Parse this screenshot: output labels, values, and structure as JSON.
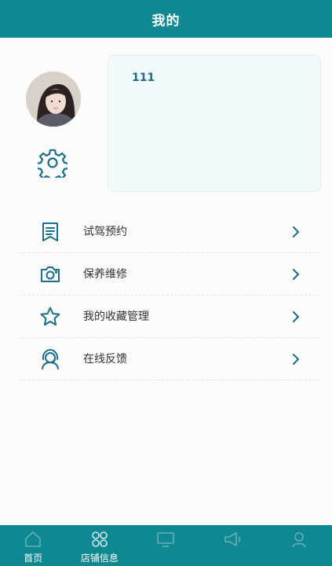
{
  "header": {
    "title": "我的"
  },
  "profile": {
    "username": "111"
  },
  "menu": {
    "items": [
      {
        "label": "试驾预约",
        "icon": "bookmark-document-icon"
      },
      {
        "label": "保养维修",
        "icon": "camera-icon"
      },
      {
        "label": "我的收藏管理",
        "icon": "star-icon"
      },
      {
        "label": "在线反馈",
        "icon": "headset-icon"
      }
    ]
  },
  "tabbar": {
    "items": [
      {
        "label": "首页",
        "icon": "home-icon"
      },
      {
        "label": "店铺信息",
        "icon": "grid-icon"
      },
      {
        "label": "",
        "icon": "screen-icon"
      },
      {
        "label": "",
        "icon": "megaphone-icon"
      },
      {
        "label": "",
        "icon": "user-icon"
      }
    ]
  },
  "colors": {
    "primary": "#0f8891",
    "icon": "#1b6d88",
    "card_bg": "#f1f9fa",
    "page_bg": "#fbfbfa"
  }
}
